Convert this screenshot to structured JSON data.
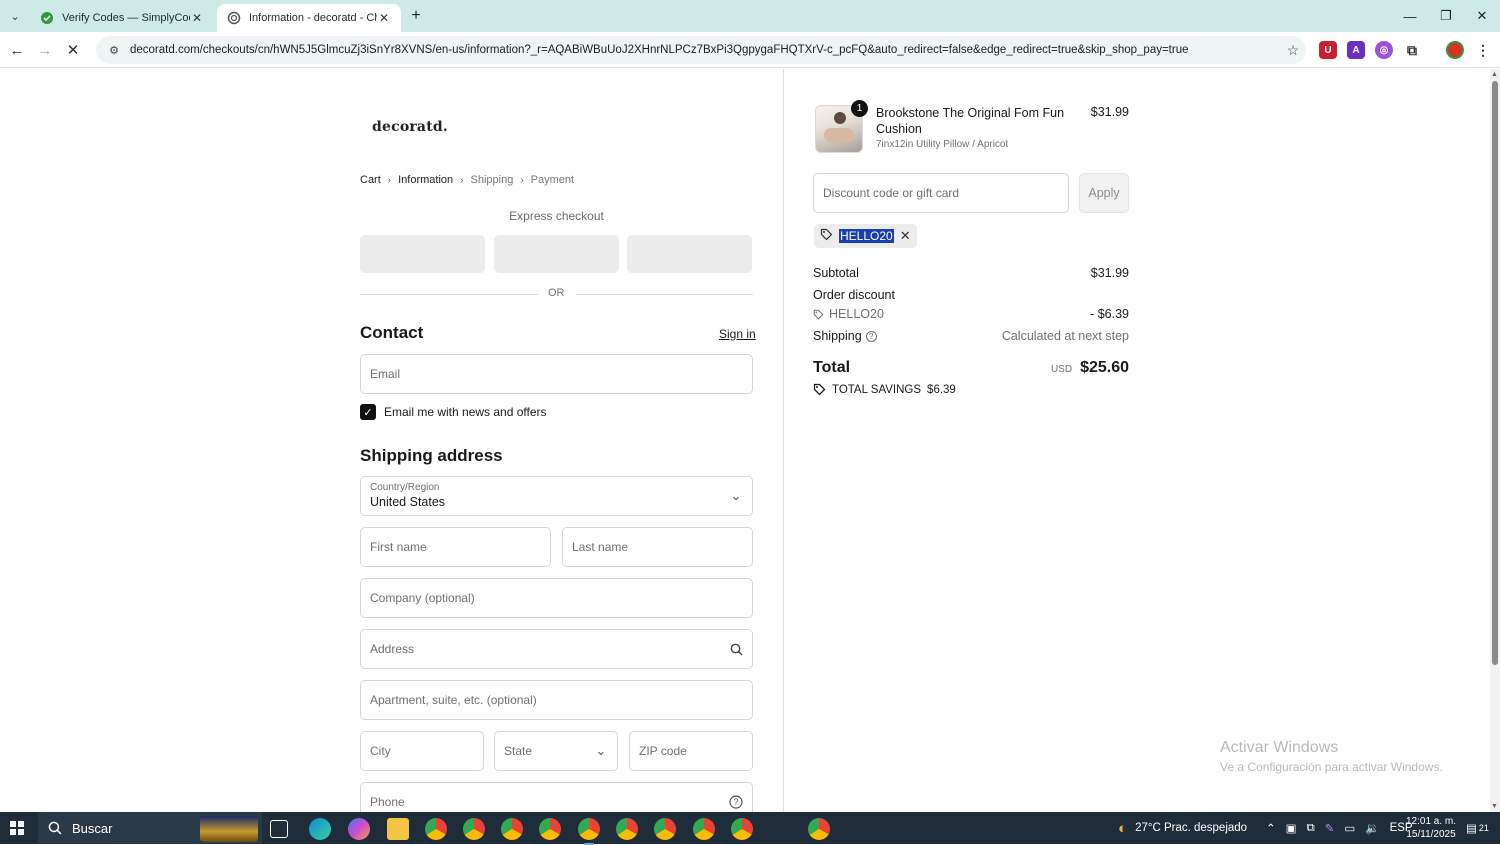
{
  "browser": {
    "tabs": [
      {
        "title": "Verify Codes — SimplyCodes",
        "favicon": "simplycodes-icon"
      },
      {
        "title": "Information - decoratd - Check",
        "favicon": "loading-icon"
      }
    ],
    "url": "decoratd.com/checkouts/cn/hWN5J5GlmcuZj3iSnYr8XVNS/en-us/information?_r=AQABiWBuUoJ2XHnrNLPCz7BxPi3QgpygaFHQTXrV-c_pcFQ&auto_redirect=false&edge_redirect=true&skip_shop_pay=true"
  },
  "store": {
    "logo": "decoratd.",
    "breadcrumbs": [
      "Cart",
      "Information",
      "Shipping",
      "Payment"
    ]
  },
  "express": {
    "title": "Express checkout",
    "or_label": "OR"
  },
  "contact": {
    "heading": "Contact",
    "sign_in": "Sign in",
    "email_placeholder": "Email",
    "newsletter_label": "Email me with news and offers",
    "newsletter_checked": true
  },
  "shipping": {
    "heading": "Shipping address",
    "country_label": "Country/Region",
    "country_value": "United States",
    "first_name": "First name",
    "last_name": "Last name",
    "company": "Company (optional)",
    "address": "Address",
    "apartment": "Apartment, suite, etc. (optional)",
    "city": "City",
    "state": "State",
    "zip": "ZIP code",
    "phone": "Phone"
  },
  "summary": {
    "product": {
      "name": "Brookstone The Original Fom Fun Cushion",
      "variant": "7inx12in Utility Pillow / Apricot",
      "price": "$31.99",
      "quantity": "1"
    },
    "discount_placeholder": "Discount code or gift card",
    "apply_label": "Apply",
    "applied_code": "HELLO20",
    "subtotal_label": "Subtotal",
    "subtotal_value": "$31.99",
    "order_discount_label": "Order discount",
    "discount_code": "HELLO20",
    "discount_value": "- $6.39",
    "shipping_label": "Shipping",
    "shipping_value": "Calculated at next step",
    "total_label": "Total",
    "currency": "USD",
    "total_value": "$25.60",
    "savings_label": "TOTAL SAVINGS",
    "savings_value": "$6.39"
  },
  "windows": {
    "activate_title": "Activar Windows",
    "activate_sub": "Ve a Configuración para activar Windows.",
    "search_label": "Buscar",
    "weather": "27°C  Prac. despejado",
    "language": "ESP",
    "time": "12:01 a. m.",
    "date": "15/11/2025",
    "notifications": "21"
  }
}
